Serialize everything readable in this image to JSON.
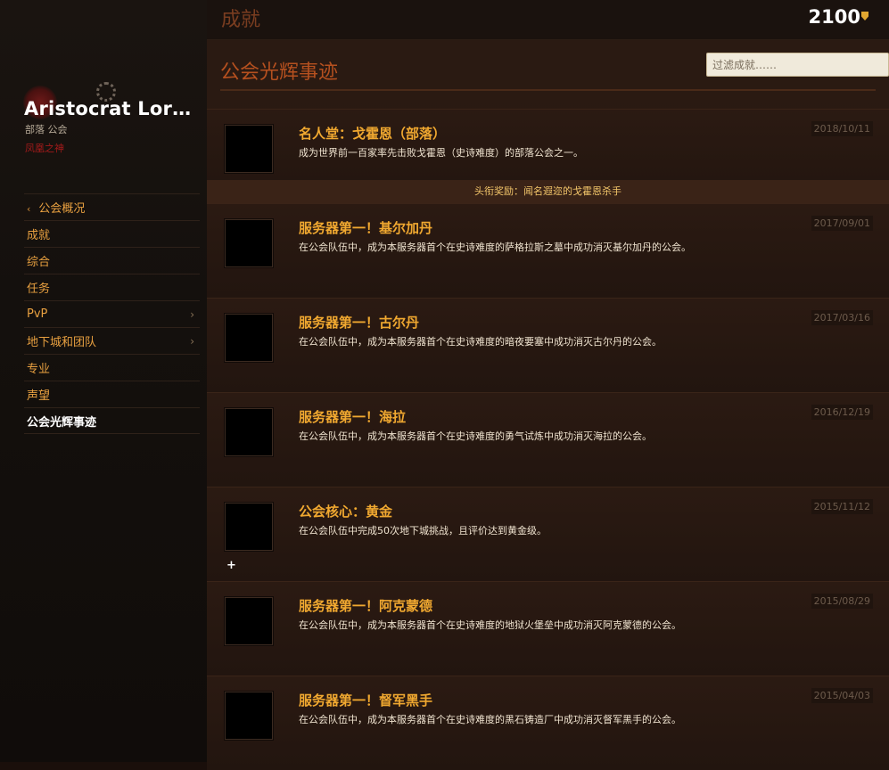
{
  "header": {
    "title": "成就",
    "points": "2100"
  },
  "guild": {
    "name": "Aristocrat Lordl...",
    "subtitle": "部落 公会",
    "realm": "凤凰之神"
  },
  "nav": {
    "items": [
      {
        "label": "公会概况",
        "back": true
      },
      {
        "label": "成就"
      },
      {
        "label": "综合"
      },
      {
        "label": "任务"
      },
      {
        "label": "PvP",
        "chevron": "›"
      },
      {
        "label": "地下城和团队",
        "chevron": "›"
      },
      {
        "label": "专业"
      },
      {
        "label": "声望"
      },
      {
        "label": "公会光辉事迹",
        "active": true
      }
    ]
  },
  "section": {
    "title": "公会光辉事迹",
    "filter_placeholder": "过滤成就……"
  },
  "achievements": [
    {
      "title": "名人堂：戈霍恩（部落）",
      "desc": "成为世界前一百家率先击败戈霍恩（史诗难度）的部落公会之一。",
      "date": "2018/10/11",
      "reward": "头衔奖励：闻名遐迩的戈霍恩杀手"
    },
    {
      "title": "服务器第一！基尔加丹",
      "desc": "在公会队伍中，成为本服务器首个在史诗难度的萨格拉斯之墓中成功消灭基尔加丹的公会。",
      "date": "2017/09/01"
    },
    {
      "title": "服务器第一！古尔丹",
      "desc": "在公会队伍中，成为本服务器首个在史诗难度的暗夜要塞中成功消灭古尔丹的公会。",
      "date": "2017/03/16"
    },
    {
      "title": "服务器第一！海拉",
      "desc": "在公会队伍中，成为本服务器首个在史诗难度的勇气试炼中成功消灭海拉的公会。",
      "date": "2016/12/19"
    },
    {
      "title": "公会核心：黄金",
      "desc": "在公会队伍中完成50次地下城挑战，且评价达到黄金级。",
      "date": "2015/11/12",
      "plus": "+"
    },
    {
      "title": "服务器第一！阿克蒙德",
      "desc": "在公会队伍中，成为本服务器首个在史诗难度的地狱火堡垒中成功消灭阿克蒙德的公会。",
      "date": "2015/08/29"
    },
    {
      "title": "服务器第一！督军黑手",
      "desc": "在公会队伍中，成为本服务器首个在史诗难度的黑石铸造厂中成功消灭督军黑手的公会。",
      "date": "2015/04/03"
    }
  ]
}
